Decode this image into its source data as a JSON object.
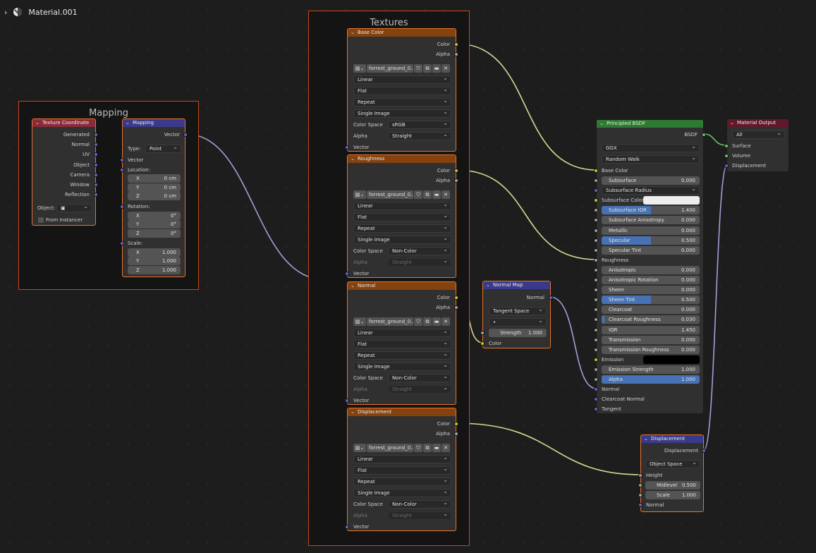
{
  "header": {
    "title": "Material.001"
  },
  "frames": {
    "mapping": "Mapping",
    "textures": "Textures"
  },
  "texcoord": {
    "title": "Texture Coordinate",
    "outputs": [
      "Generated",
      "Normal",
      "UV",
      "Object",
      "Camera",
      "Window",
      "Reflection"
    ],
    "object_label": "Object:",
    "from_instancer": "From Instancer"
  },
  "mapping": {
    "title": "Mapping",
    "out": "Vector",
    "type_label": "Type:",
    "type_value": "Point",
    "vector_label": "Vector",
    "location_label": "Location:",
    "rotation_label": "Rotation:",
    "scale_label": "Scale:",
    "axes": [
      "X",
      "Y",
      "Z"
    ],
    "location": [
      "0 cm",
      "0 cm",
      "0 cm"
    ],
    "rotation": [
      "0°",
      "0°",
      "0°"
    ],
    "scale": [
      "1.000",
      "1.000",
      "1.000"
    ]
  },
  "tex_nodes": [
    {
      "title": "Base Color",
      "image": "forrest_ground_0...",
      "interp": "Linear",
      "proj": "Flat",
      "ext": "Repeat",
      "src": "Single Image",
      "cs_label": "Color Space",
      "cs": "sRGB",
      "alpha_label": "Alpha",
      "alpha": "Straight",
      "out_color": "Color",
      "out_alpha": "Alpha",
      "in_vector": "Vector"
    },
    {
      "title": "Roughness",
      "image": "forrest_ground_0...",
      "interp": "Linear",
      "proj": "Flat",
      "ext": "Repeat",
      "src": "Single Image",
      "cs_label": "Color Space",
      "cs": "Non-Color",
      "alpha_label": "Alpha",
      "alpha": "Straight",
      "out_color": "Color",
      "out_alpha": "Alpha",
      "in_vector": "Vector"
    },
    {
      "title": "Normal",
      "image": "forrest_ground_0...",
      "interp": "Linear",
      "proj": "Flat",
      "ext": "Repeat",
      "src": "Single Image",
      "cs_label": "Color Space",
      "cs": "Non-Color",
      "alpha_label": "Alpha",
      "alpha": "Straight",
      "out_color": "Color",
      "out_alpha": "Alpha",
      "in_vector": "Vector"
    },
    {
      "title": "Displacement",
      "image": "forrest_ground_0...",
      "interp": "Linear",
      "proj": "Flat",
      "ext": "Repeat",
      "src": "Single Image",
      "cs_label": "Color Space",
      "cs": "Non-Color",
      "alpha_label": "Alpha",
      "alpha": "Straight",
      "out_color": "Color",
      "out_alpha": "Alpha",
      "in_vector": "Vector"
    }
  ],
  "normalmap": {
    "title": "Normal Map",
    "out": "Normal",
    "space": "Tangent Space",
    "uv": "•",
    "strength_label": "Strength",
    "strength": "1.000",
    "in_color": "Color"
  },
  "bsdf": {
    "title": "Principled BSDF",
    "out": "BSDF",
    "distribution": "GGX",
    "subsurface_method": "Random Walk",
    "base_color": "Base Color",
    "fields": [
      {
        "label": "Subsurface",
        "value": "0.000",
        "fill": 0
      },
      {
        "label": "Subsurface Radius",
        "value": "",
        "fill": 0
      },
      {
        "label": "Subsurface Color",
        "value": "",
        "fill": 0
      },
      {
        "label": "Subsurface IOR",
        "value": "1.400",
        "fill": 0.5
      },
      {
        "label": "Subsurface Anisotropy",
        "value": "0.000",
        "fill": 0
      },
      {
        "label": "Metallic",
        "value": "0.000",
        "fill": 0
      },
      {
        "label": "Specular",
        "value": "0.500",
        "fill": 0.5
      },
      {
        "label": "Specular Tint",
        "value": "0.000",
        "fill": 0
      },
      {
        "label": "Roughness",
        "value": "",
        "fill": 0
      },
      {
        "label": "Anisotropic",
        "value": "0.000",
        "fill": 0
      },
      {
        "label": "Anisotropic Rotation",
        "value": "0.000",
        "fill": 0
      },
      {
        "label": "Sheen",
        "value": "0.000",
        "fill": 0
      },
      {
        "label": "Sheen Tint",
        "value": "0.500",
        "fill": 0.5
      },
      {
        "label": "Clearcoat",
        "value": "0.000",
        "fill": 0
      },
      {
        "label": "Clearcoat Roughness",
        "value": "0.030",
        "fill": 0.03
      },
      {
        "label": "IOR",
        "value": "1.450",
        "fill": 0
      },
      {
        "label": "Transmission",
        "value": "0.000",
        "fill": 0
      },
      {
        "label": "Transmission Roughness",
        "value": "0.000",
        "fill": 0
      },
      {
        "label": "Emission",
        "value": "",
        "fill": 0
      },
      {
        "label": "Emission Strength",
        "value": "1.000",
        "fill": 0
      },
      {
        "label": "Alpha",
        "value": "1.000",
        "fill": 1
      }
    ],
    "normal": "Normal",
    "clearcoat_normal": "Clearcoat Normal",
    "tangent": "Tangent"
  },
  "matout": {
    "title": "Material Output",
    "target": "All",
    "surface": "Surface",
    "volume": "Volume",
    "displacement": "Displacement"
  },
  "disp": {
    "title": "Displacement",
    "out": "Displacement",
    "space": "Object Space",
    "height": "Height",
    "midlevel_label": "Midlevel",
    "midlevel": "0.500",
    "scale_label": "Scale",
    "scale": "1.000",
    "normal": "Normal"
  },
  "colors": {
    "texture_header": "#83420e",
    "vector_header": "#3a3a8c",
    "input_header": "#8c2a3a",
    "shader_header": "#2f7a32",
    "output_header": "#61182a",
    "frame_border": "#c8441c"
  }
}
